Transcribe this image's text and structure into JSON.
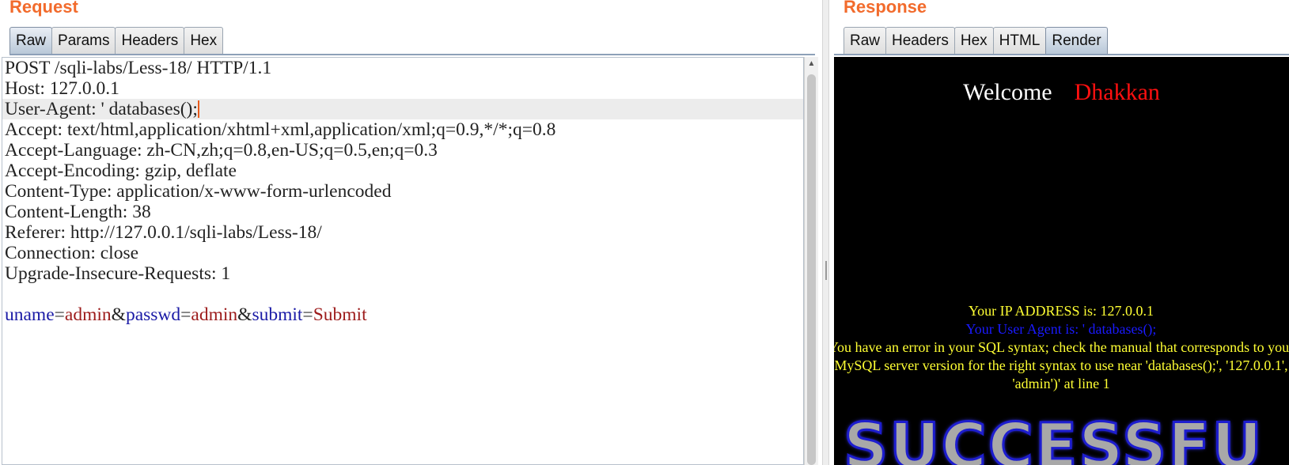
{
  "request": {
    "title": "Request",
    "tabs": [
      "Raw",
      "Params",
      "Headers",
      "Hex"
    ],
    "lines": [
      "POST /sqli-labs/Less-18/ HTTP/1.1",
      "Host: 127.0.0.1",
      "User-Agent: ' databases();",
      "Accept: text/html,application/xhtml+xml,application/xml;q=0.9,*/*;q=0.8",
      "Accept-Language: zh-CN,zh;q=0.8,en-US;q=0.5,en;q=0.3",
      "Accept-Encoding: gzip, deflate",
      "Content-Type: application/x-www-form-urlencoded",
      "Content-Length: 38",
      "Referer: http://127.0.0.1/sqli-labs/Less-18/",
      "Connection: close",
      "Upgrade-Insecure-Requests: 1",
      ""
    ],
    "body_params": [
      {
        "name": "uname",
        "value": "admin"
      },
      {
        "name": "passwd",
        "value": "admin"
      },
      {
        "name": "submit",
        "value": "Submit"
      }
    ]
  },
  "response": {
    "title": "Response",
    "tabs": [
      "Raw",
      "Headers",
      "Hex",
      "HTML",
      "Render"
    ],
    "welcome": "Welcome",
    "name": "Dhakkan",
    "ip_line": "Your IP ADDRESS is: 127.0.0.1",
    "ua_line": "Your User Agent is: ' databases();",
    "error_text": "You have an error in your SQL syntax; check the manual that corresponds to your MySQL server version for the right syntax to use near 'databases();', '127.0.0.1', 'admin')' at line 1",
    "banner": "SUCCESSFU"
  }
}
